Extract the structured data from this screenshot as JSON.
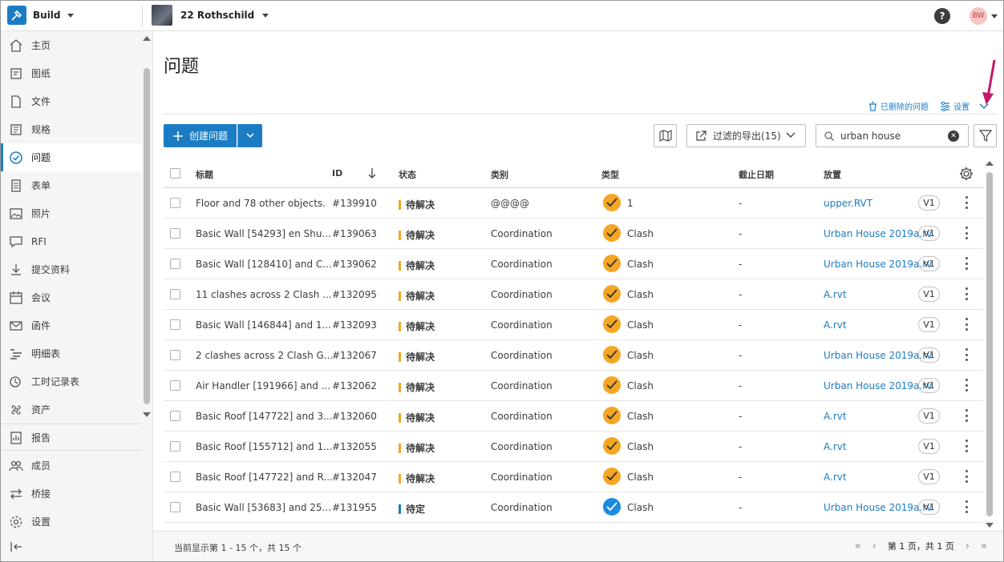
{
  "app": {
    "name": "Build",
    "project": "22 Rothschild",
    "user_initials": "BW"
  },
  "sidebar": {
    "items": [
      {
        "label": "主页",
        "icon": "home-icon"
      },
      {
        "label": "图纸",
        "icon": "sheets-icon"
      },
      {
        "label": "文件",
        "icon": "files-icon"
      },
      {
        "label": "规格",
        "icon": "specs-icon"
      },
      {
        "label": "问题",
        "icon": "issues-icon",
        "active": true
      },
      {
        "label": "表单",
        "icon": "forms-icon"
      },
      {
        "label": "照片",
        "icon": "photos-icon"
      },
      {
        "label": "RFI",
        "icon": "rfi-icon"
      },
      {
        "label": "提交资料",
        "icon": "submittals-icon"
      },
      {
        "label": "会议",
        "icon": "meetings-icon"
      },
      {
        "label": "函件",
        "icon": "correspondence-icon"
      },
      {
        "label": "明细表",
        "icon": "schedule-icon"
      },
      {
        "label": "工时记录表",
        "icon": "timesheet-icon"
      },
      {
        "label": "资产",
        "icon": "assets-icon"
      },
      {
        "label": "报告",
        "icon": "reports-icon"
      },
      {
        "label": "成员",
        "icon": "members-icon"
      },
      {
        "label": "桥接",
        "icon": "bridge-icon"
      },
      {
        "label": "设置",
        "icon": "settings-icon"
      }
    ]
  },
  "page": {
    "title": "问题",
    "deleted_link": "已删除的问题",
    "settings_link": "设置"
  },
  "toolbar": {
    "create_label": "创建问题",
    "export_label": "过滤的导出(15)",
    "search_value": "urban house"
  },
  "table": {
    "headers": {
      "title": "标题",
      "id": "ID",
      "status": "状态",
      "category": "类别",
      "type": "类型",
      "due": "截止日期",
      "placement": "放置"
    },
    "rows": [
      {
        "title": "Floor and 78 other objects.",
        "id": "#139910",
        "status": "待解决",
        "category": "@@@@",
        "type": "1",
        "due": "-",
        "placement": "upper.RVT",
        "version": "V1",
        "status_color": "#f5a623",
        "type_color": "#f5a623"
      },
      {
        "title": "Basic Wall [54293] en Shu...",
        "id": "#139063",
        "status": "待解决",
        "category": "Coordination",
        "type": "Clash",
        "due": "-",
        "placement": "Urban House 2019a.rv",
        "version": "V1",
        "status_color": "#f5a623",
        "type_color": "#f5a623"
      },
      {
        "title": "Basic Wall [128410] and C...",
        "id": "#139062",
        "status": "待解决",
        "category": "Coordination",
        "type": "Clash",
        "due": "-",
        "placement": "Urban House 2019a.rv",
        "version": "V1",
        "status_color": "#f5a623",
        "type_color": "#f5a623"
      },
      {
        "title": "11 clashes across 2 Clash ...",
        "id": "#132095",
        "status": "待解决",
        "category": "Coordination",
        "type": "Clash",
        "due": "-",
        "placement": "A.rvt",
        "version": "V1",
        "status_color": "#f5a623",
        "type_color": "#f5a623"
      },
      {
        "title": "Basic Wall [146844] and 1...",
        "id": "#132093",
        "status": "待解决",
        "category": "Coordination",
        "type": "Clash",
        "due": "-",
        "placement": "A.rvt",
        "version": "V1",
        "status_color": "#f5a623",
        "type_color": "#f5a623"
      },
      {
        "title": "2 clashes across 2 Clash G...",
        "id": "#132067",
        "status": "待解决",
        "category": "Coordination",
        "type": "Clash",
        "due": "-",
        "placement": "Urban House 2019a.rv",
        "version": "V1",
        "status_color": "#f5a623",
        "type_color": "#f5a623"
      },
      {
        "title": "Air Handler [191966] and ...",
        "id": "#132062",
        "status": "待解决",
        "category": "Coordination",
        "type": "Clash",
        "due": "-",
        "placement": "Urban House 2019a.rv",
        "version": "V1",
        "status_color": "#f5a623",
        "type_color": "#f5a623"
      },
      {
        "title": "Basic Roof [147722] and 3...",
        "id": "#132060",
        "status": "待解决",
        "category": "Coordination",
        "type": "Clash",
        "due": "-",
        "placement": "A.rvt",
        "version": "V1",
        "status_color": "#f5a623",
        "type_color": "#f5a623"
      },
      {
        "title": "Basic Roof [155712] and 1...",
        "id": "#132055",
        "status": "待解决",
        "category": "Coordination",
        "type": "Clash",
        "due": "-",
        "placement": "A.rvt",
        "version": "V1",
        "status_color": "#f5a623",
        "type_color": "#f5a623"
      },
      {
        "title": "Basic Roof [147722] and R...",
        "id": "#132047",
        "status": "待解决",
        "category": "Coordination",
        "type": "Clash",
        "due": "-",
        "placement": "A.rvt",
        "version": "V1",
        "status_color": "#f5a623",
        "type_color": "#f5a623"
      },
      {
        "title": "Basic Wall [53683] and 25...",
        "id": "#131955",
        "status": "待定",
        "category": "Coordination",
        "type": "Clash",
        "due": "-",
        "placement": "Urban House 2019a.rv",
        "version": "V1",
        "status_color": "#1b7cc4",
        "type_color": "#1b8ce0"
      }
    ]
  },
  "footer": {
    "summary": "当前显示第 1 - 15 个，共 15 个",
    "page_info": "第 1 页，共 1 页"
  },
  "colors": {
    "accent": "#1b7cc4",
    "pending": "#f5a623",
    "annotation": "#c2186b"
  }
}
